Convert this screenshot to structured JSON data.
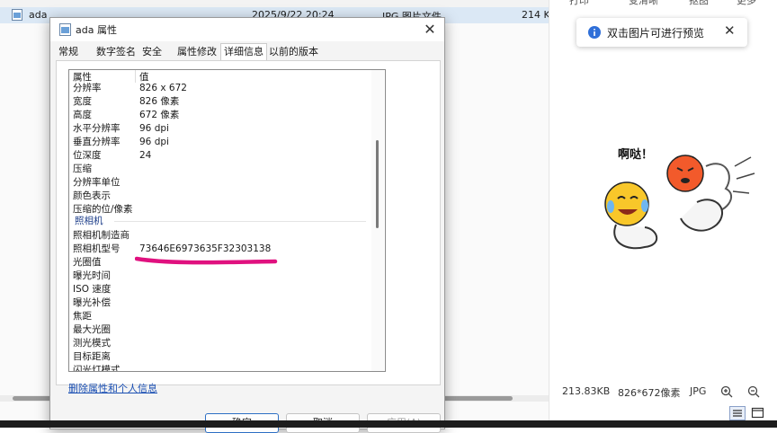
{
  "explorer": {
    "top_ghost": "",
    "file": {
      "name": "ada",
      "date": "2025/9/22 20:24",
      "type": "JPG 图片文件",
      "size": "214 K"
    }
  },
  "dialog": {
    "title": "ada 属性",
    "tabs": [
      "常规",
      "数字签名",
      "安全",
      "属性修改",
      "详细信息",
      "以前的版本"
    ],
    "active_tab": 4,
    "header": {
      "name": "属性",
      "value": "值"
    },
    "rows_image": [
      {
        "name": "分辨率",
        "value": "826 x 672"
      },
      {
        "name": "宽度",
        "value": "826 像素"
      },
      {
        "name": "高度",
        "value": "672 像素"
      },
      {
        "name": "水平分辨率",
        "value": "96 dpi"
      },
      {
        "name": "垂直分辨率",
        "value": "96 dpi"
      },
      {
        "name": "位深度",
        "value": "24"
      },
      {
        "name": "压缩",
        "value": ""
      },
      {
        "name": "分辨率单位",
        "value": ""
      },
      {
        "name": "颜色表示",
        "value": ""
      },
      {
        "name": "压缩的位/像素",
        "value": ""
      }
    ],
    "section_camera": "照相机",
    "rows_camera": [
      {
        "name": "照相机制造商",
        "value": ""
      },
      {
        "name": "照相机型号",
        "value": "73646E6973635F32303138"
      },
      {
        "name": "光圈值",
        "value": ""
      },
      {
        "name": "曝光时间",
        "value": ""
      },
      {
        "name": "ISO 速度",
        "value": ""
      },
      {
        "name": "曝光补偿",
        "value": ""
      },
      {
        "name": "焦距",
        "value": ""
      },
      {
        "name": "最大光圈",
        "value": ""
      },
      {
        "name": "测光模式",
        "value": ""
      },
      {
        "name": "目标距离",
        "value": ""
      },
      {
        "name": "闪光灯模式",
        "value": ""
      }
    ],
    "remove_link": "删除属性和个人信息",
    "buttons": {
      "ok": "确定",
      "cancel": "取消",
      "apply": "应用(A)"
    },
    "annotation_color": "#e0117f"
  },
  "viewer": {
    "top_actions": [
      "打印",
      "变清晰",
      "抠图",
      "更多"
    ],
    "tooltip": "双击图片可进行预览",
    "preview_caption": "啊哒！",
    "status": {
      "size": "213.83KB",
      "dimensions": "826*672像素",
      "format": "JPG"
    },
    "icons": [
      "zoom-in-icon",
      "zoom-out-icon",
      "list-view-icon",
      "window-icon"
    ]
  },
  "colors": {
    "accent": "#2d6fc4",
    "link": "#1a4fb3",
    "tooltip_info": "#2f6fd8"
  }
}
